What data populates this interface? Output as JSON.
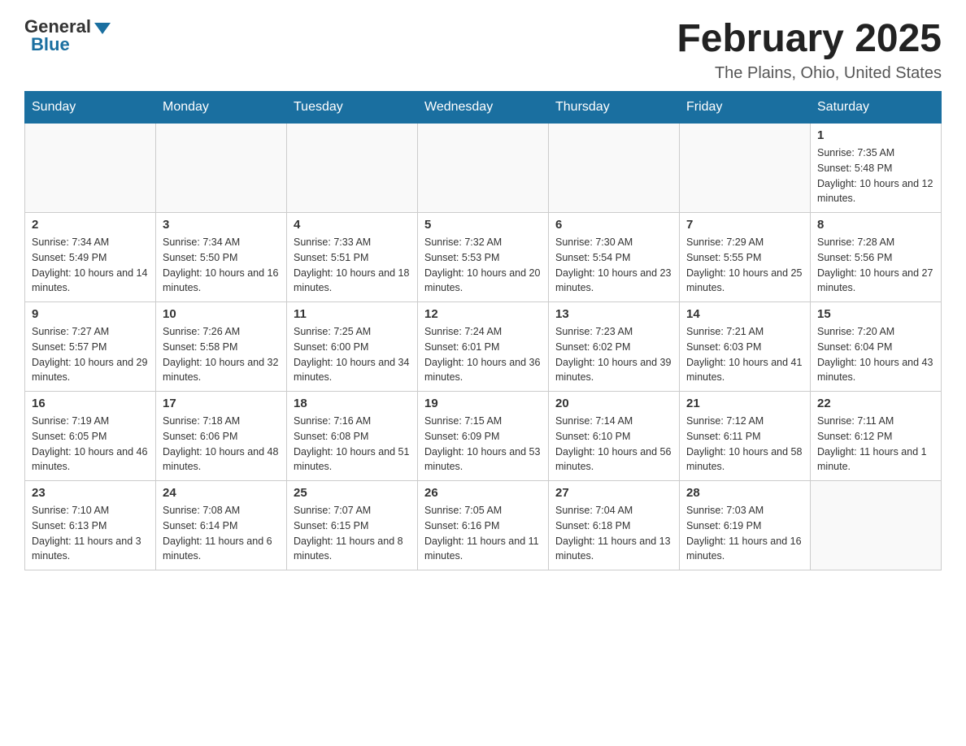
{
  "header": {
    "logo_general": "General",
    "logo_blue": "Blue",
    "month_title": "February 2025",
    "location": "The Plains, Ohio, United States"
  },
  "days_of_week": [
    "Sunday",
    "Monday",
    "Tuesday",
    "Wednesday",
    "Thursday",
    "Friday",
    "Saturday"
  ],
  "weeks": [
    [
      {
        "day": "",
        "info": ""
      },
      {
        "day": "",
        "info": ""
      },
      {
        "day": "",
        "info": ""
      },
      {
        "day": "",
        "info": ""
      },
      {
        "day": "",
        "info": ""
      },
      {
        "day": "",
        "info": ""
      },
      {
        "day": "1",
        "info": "Sunrise: 7:35 AM\nSunset: 5:48 PM\nDaylight: 10 hours and 12 minutes."
      }
    ],
    [
      {
        "day": "2",
        "info": "Sunrise: 7:34 AM\nSunset: 5:49 PM\nDaylight: 10 hours and 14 minutes."
      },
      {
        "day": "3",
        "info": "Sunrise: 7:34 AM\nSunset: 5:50 PM\nDaylight: 10 hours and 16 minutes."
      },
      {
        "day": "4",
        "info": "Sunrise: 7:33 AM\nSunset: 5:51 PM\nDaylight: 10 hours and 18 minutes."
      },
      {
        "day": "5",
        "info": "Sunrise: 7:32 AM\nSunset: 5:53 PM\nDaylight: 10 hours and 20 minutes."
      },
      {
        "day": "6",
        "info": "Sunrise: 7:30 AM\nSunset: 5:54 PM\nDaylight: 10 hours and 23 minutes."
      },
      {
        "day": "7",
        "info": "Sunrise: 7:29 AM\nSunset: 5:55 PM\nDaylight: 10 hours and 25 minutes."
      },
      {
        "day": "8",
        "info": "Sunrise: 7:28 AM\nSunset: 5:56 PM\nDaylight: 10 hours and 27 minutes."
      }
    ],
    [
      {
        "day": "9",
        "info": "Sunrise: 7:27 AM\nSunset: 5:57 PM\nDaylight: 10 hours and 29 minutes."
      },
      {
        "day": "10",
        "info": "Sunrise: 7:26 AM\nSunset: 5:58 PM\nDaylight: 10 hours and 32 minutes."
      },
      {
        "day": "11",
        "info": "Sunrise: 7:25 AM\nSunset: 6:00 PM\nDaylight: 10 hours and 34 minutes."
      },
      {
        "day": "12",
        "info": "Sunrise: 7:24 AM\nSunset: 6:01 PM\nDaylight: 10 hours and 36 minutes."
      },
      {
        "day": "13",
        "info": "Sunrise: 7:23 AM\nSunset: 6:02 PM\nDaylight: 10 hours and 39 minutes."
      },
      {
        "day": "14",
        "info": "Sunrise: 7:21 AM\nSunset: 6:03 PM\nDaylight: 10 hours and 41 minutes."
      },
      {
        "day": "15",
        "info": "Sunrise: 7:20 AM\nSunset: 6:04 PM\nDaylight: 10 hours and 43 minutes."
      }
    ],
    [
      {
        "day": "16",
        "info": "Sunrise: 7:19 AM\nSunset: 6:05 PM\nDaylight: 10 hours and 46 minutes."
      },
      {
        "day": "17",
        "info": "Sunrise: 7:18 AM\nSunset: 6:06 PM\nDaylight: 10 hours and 48 minutes."
      },
      {
        "day": "18",
        "info": "Sunrise: 7:16 AM\nSunset: 6:08 PM\nDaylight: 10 hours and 51 minutes."
      },
      {
        "day": "19",
        "info": "Sunrise: 7:15 AM\nSunset: 6:09 PM\nDaylight: 10 hours and 53 minutes."
      },
      {
        "day": "20",
        "info": "Sunrise: 7:14 AM\nSunset: 6:10 PM\nDaylight: 10 hours and 56 minutes."
      },
      {
        "day": "21",
        "info": "Sunrise: 7:12 AM\nSunset: 6:11 PM\nDaylight: 10 hours and 58 minutes."
      },
      {
        "day": "22",
        "info": "Sunrise: 7:11 AM\nSunset: 6:12 PM\nDaylight: 11 hours and 1 minute."
      }
    ],
    [
      {
        "day": "23",
        "info": "Sunrise: 7:10 AM\nSunset: 6:13 PM\nDaylight: 11 hours and 3 minutes."
      },
      {
        "day": "24",
        "info": "Sunrise: 7:08 AM\nSunset: 6:14 PM\nDaylight: 11 hours and 6 minutes."
      },
      {
        "day": "25",
        "info": "Sunrise: 7:07 AM\nSunset: 6:15 PM\nDaylight: 11 hours and 8 minutes."
      },
      {
        "day": "26",
        "info": "Sunrise: 7:05 AM\nSunset: 6:16 PM\nDaylight: 11 hours and 11 minutes."
      },
      {
        "day": "27",
        "info": "Sunrise: 7:04 AM\nSunset: 6:18 PM\nDaylight: 11 hours and 13 minutes."
      },
      {
        "day": "28",
        "info": "Sunrise: 7:03 AM\nSunset: 6:19 PM\nDaylight: 11 hours and 16 minutes."
      },
      {
        "day": "",
        "info": ""
      }
    ]
  ]
}
